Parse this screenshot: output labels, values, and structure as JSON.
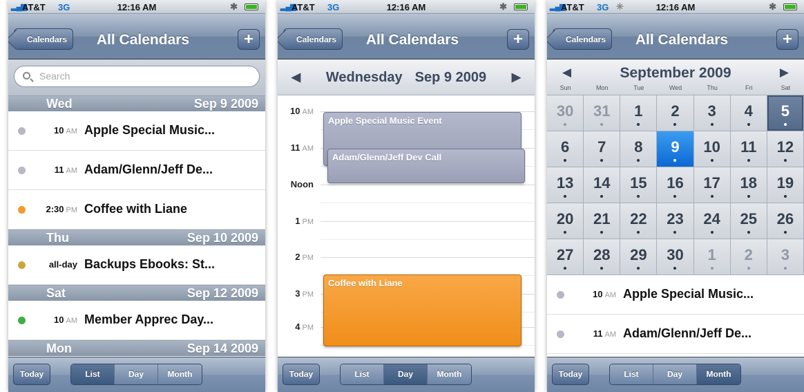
{
  "status": {
    "carrier": "AT&T",
    "network": "3G",
    "time": "12:16 AM"
  },
  "nav": {
    "back_label": "Calendars",
    "title": "All Calendars",
    "add_label": "+"
  },
  "toolbar": {
    "today": "Today",
    "segments": [
      "List",
      "Day",
      "Month"
    ]
  },
  "list_view": {
    "search_placeholder": "Search",
    "sections": [
      {
        "day": "Wed",
        "date": "Sep 9 2009"
      },
      {
        "day": "Thu",
        "date": "Sep 10 2009"
      },
      {
        "day": "Sat",
        "date": "Sep 12 2009"
      },
      {
        "day": "Mon",
        "date": "Sep 14 2009"
      }
    ],
    "events": [
      {
        "time": "10",
        "ampm": "AM",
        "title": "Apple Special Music...",
        "color": "#b8b8c4"
      },
      {
        "time": "11",
        "ampm": "AM",
        "title": "Adam/Glenn/Jeff De...",
        "color": "#b8b8c4"
      },
      {
        "time": "2:30",
        "ampm": "PM",
        "title": "Coffee with Liane",
        "color": "#f59a2c"
      },
      {
        "time": "all-day",
        "ampm": "",
        "title": "Backups Ebooks: St...",
        "color": "#c9a73a"
      },
      {
        "time": "10",
        "ampm": "AM",
        "title": "Member Apprec Day...",
        "color": "#3cb043"
      }
    ]
  },
  "day_view": {
    "weekday": "Wednesday",
    "date": "Sep 9 2009",
    "hours": [
      {
        "h": "10",
        "ampm": "AM"
      },
      {
        "h": "11",
        "ampm": "AM"
      },
      {
        "h": "Noon",
        "ampm": ""
      },
      {
        "h": "1",
        "ampm": "PM"
      },
      {
        "h": "2",
        "ampm": "PM"
      },
      {
        "h": "3",
        "ampm": "PM"
      },
      {
        "h": "4",
        "ampm": "PM"
      }
    ],
    "events": [
      {
        "title": "Apple Special Music Event",
        "color": "#a3a8be"
      },
      {
        "title": "Adam/Glenn/Jeff Dev Call",
        "color": "#a3a8be"
      },
      {
        "title": "Coffee with Liane",
        "color": "#f59a2c"
      }
    ]
  },
  "month_view": {
    "title": "September 2009",
    "weekdays": [
      "Sun",
      "Mon",
      "Tue",
      "Wed",
      "Thu",
      "Fri",
      "Sat"
    ],
    "days": [
      "30",
      "31",
      "1",
      "2",
      "3",
      "4",
      "5",
      "6",
      "7",
      "8",
      "9",
      "10",
      "11",
      "12",
      "13",
      "14",
      "15",
      "16",
      "17",
      "18",
      "19",
      "20",
      "21",
      "22",
      "23",
      "24",
      "25",
      "26",
      "27",
      "28",
      "29",
      "30",
      "1",
      "2",
      "3"
    ],
    "selected_day": "9",
    "today_day": "5",
    "events": [
      {
        "time": "10",
        "ampm": "AM",
        "title": "Apple Special Music...",
        "color": "#b8b8c4"
      },
      {
        "time": "11",
        "ampm": "AM",
        "title": "Adam/Glenn/Jeff De...",
        "color": "#b8b8c4"
      }
    ]
  }
}
